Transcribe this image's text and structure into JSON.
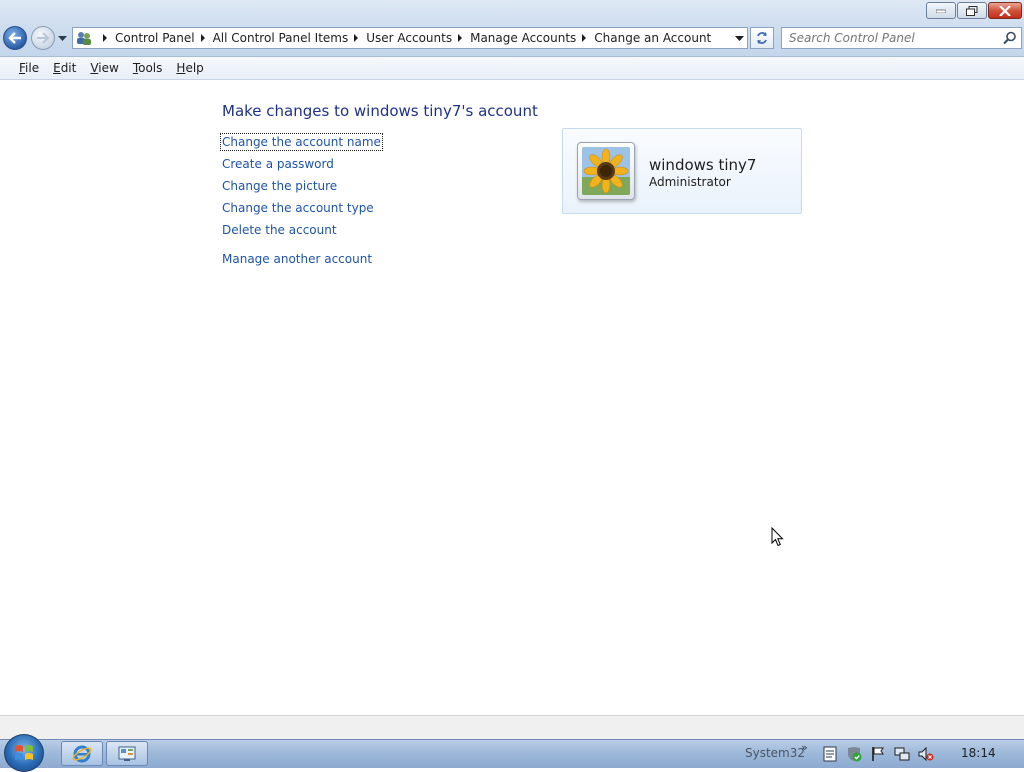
{
  "window": {
    "caption_buttons": [
      "minimize",
      "restore",
      "close"
    ]
  },
  "address_bar": {
    "breadcrumbs": [
      "Control Panel",
      "All Control Panel Items",
      "User Accounts",
      "Manage Accounts",
      "Change an Account"
    ]
  },
  "search": {
    "placeholder": "Search Control Panel"
  },
  "menu": {
    "items": [
      "File",
      "Edit",
      "View",
      "Tools",
      "Help"
    ]
  },
  "page": {
    "title": "Make changes to windows tiny7's account",
    "tasks": [
      "Change the account name",
      "Create a password",
      "Change the picture",
      "Change the account type",
      "Delete the account"
    ],
    "manage_other": "Manage another account"
  },
  "account": {
    "name": "windows tiny7",
    "role": "Administrator",
    "picture_icon": "sunflower-picture"
  },
  "taskbar": {
    "toolbar_label": "System32",
    "toolbar_chevron": "»",
    "clock": "18:14",
    "pinned": [
      "internet-explorer-icon",
      "control-panel-icon"
    ],
    "tray_icons": [
      "notes-icon",
      "security-shield-icon",
      "action-center-flag-icon",
      "network-icon",
      "volume-muted-icon"
    ]
  },
  "colors": {
    "link": "#1e54a6",
    "title": "#1e3287",
    "chrome": "#c4d6ec",
    "taskbar": "#9cb7d9"
  }
}
